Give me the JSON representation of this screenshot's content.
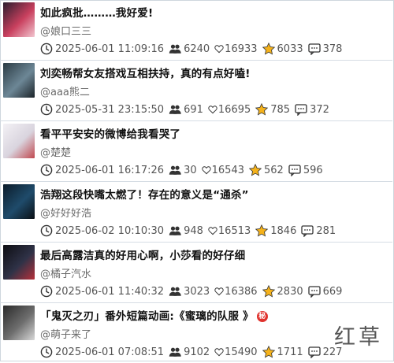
{
  "items": [
    {
      "title": "如此疯批………我好爱!",
      "author": "@娘口三三",
      "time": "2025-06-01 11:09:16",
      "views": "6240",
      "likes": "16933",
      "favs": "6033",
      "comments": "378",
      "thumb": [
        "#2a1d2e",
        "#c9405e",
        "#f2c6d0"
      ],
      "badge": ""
    },
    {
      "title": "刘奕畅帮女友搭戏互相扶持，真的有点好嗑!",
      "author": "@aaa熊二",
      "time": "2025-05-31 23:15:50",
      "views": "691",
      "likes": "16695",
      "favs": "785",
      "comments": "372",
      "thumb": [
        "#2b3b44",
        "#6d8796",
        "#1b2328"
      ],
      "badge": ""
    },
    {
      "title": "看平平安安的微博给我看哭了",
      "author": "@楚楚",
      "time": "2025-06-01 16:17:26",
      "views": "30",
      "likes": "16543",
      "favs": "562",
      "comments": "596",
      "thumb": [
        "#f3f1f5",
        "#d9d4de",
        "#c0484f"
      ],
      "badge": ""
    },
    {
      "title": "浩翔这段快嘴太燃了！存在的意义是“通杀”",
      "author": "@好好好浩",
      "time": "2025-06-02 10:10:30",
      "views": "948",
      "likes": "16513",
      "favs": "1846",
      "comments": "281",
      "thumb": [
        "#0b1c2a",
        "#1f4b6b",
        "#0a0f14"
      ],
      "badge": ""
    },
    {
      "title": "最后高露洁真的好用心啊，小莎看的好仔细",
      "author": "@橘子汽水",
      "time": "2025-06-01 11:40:32",
      "views": "3023",
      "likes": "16386",
      "favs": "2830",
      "comments": "669",
      "thumb": [
        "#0d0d12",
        "#2f3247",
        "#b6303a"
      ],
      "badge": ""
    },
    {
      "title": "「鬼灭之刃」番外短篇动画:《蜜璃的队服 》",
      "author": "@萌子来了",
      "time": "2025-06-01 07:08:51",
      "views": "9102",
      "likes": "15490",
      "favs": "1711",
      "comments": "227",
      "thumb": [
        "#2a2a2a",
        "#6e6e6e",
        "#d8d8d8"
      ],
      "badge": "秘"
    }
  ],
  "watermark": "红草",
  "icons": {
    "time": "clock-icon",
    "views": "people-icon",
    "likes": "heart-icon",
    "favs": "star-icon",
    "comments": "comment-icon"
  },
  "colors": {
    "star": "#f5b21b",
    "border": "#d6dde4",
    "badge": "#e0322d"
  }
}
